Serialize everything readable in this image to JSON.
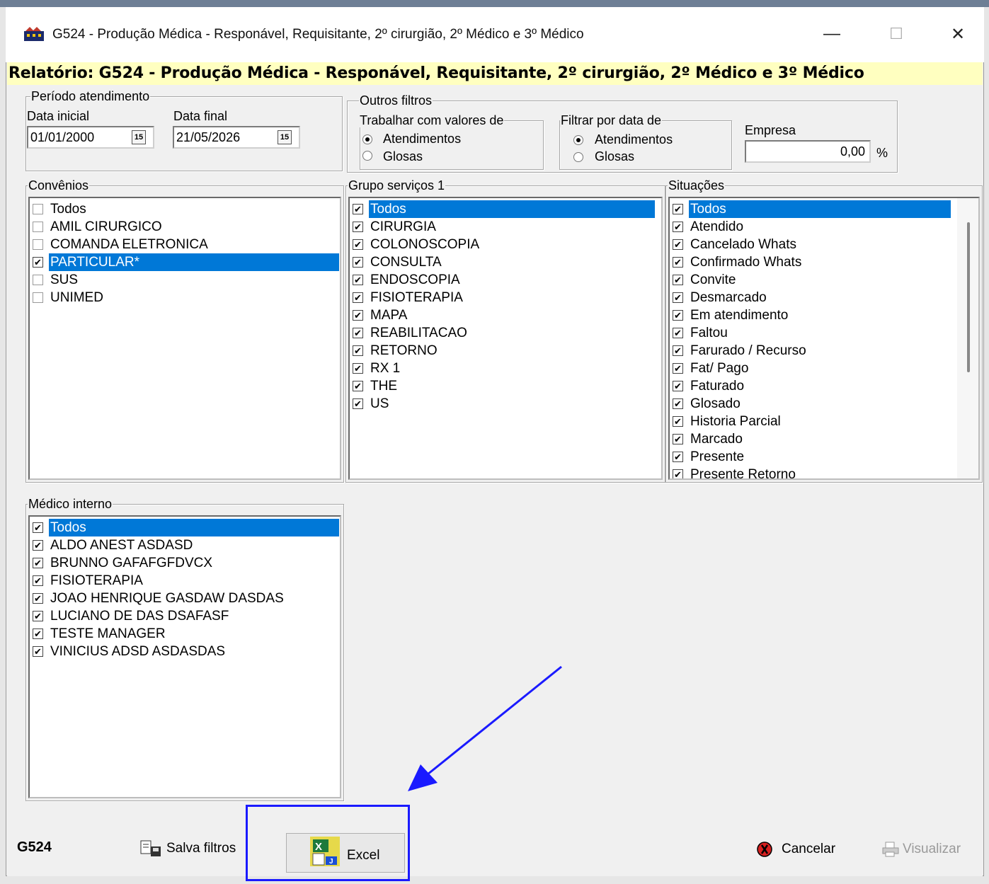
{
  "window": {
    "title": "G524 - Produção Médica - Responável, Requisitante, 2º cirurgião, 2º Médico e 3º Médico",
    "minimize": "—",
    "maximize": "☐",
    "close": "✕"
  },
  "report_header": "Relatório: G524 - Produção Médica - Responável, Requisitante, 2º cirurgião, 2º Médico e 3º Médico",
  "periodo": {
    "legend": "Período atendimento",
    "data_inicial_label": "Data inicial",
    "data_inicial": "01/01/2000",
    "data_final_label": "Data final",
    "data_final": "21/05/2026",
    "cal_icon": "15"
  },
  "outros_filtros": {
    "legend": "Outros filtros",
    "trabalhar": {
      "legend": "Trabalhar com valores de",
      "options": [
        "Atendimentos",
        "Glosas"
      ],
      "selected": "Atendimentos"
    },
    "filtrar": {
      "legend": "Filtrar por data de",
      "options": [
        "Atendimentos",
        "Glosas"
      ],
      "selected": "Atendimentos"
    },
    "empresa_label": "Empresa",
    "empresa_value": "0,00",
    "empresa_unit": "%"
  },
  "convenios": {
    "legend": "Convênios",
    "items": [
      {
        "label": "Todos",
        "checked": false,
        "selected": false
      },
      {
        "label": "AMIL  CIRURGICO",
        "checked": false,
        "selected": false
      },
      {
        "label": "COMANDA ELETRONICA",
        "checked": false,
        "selected": false
      },
      {
        "label": "PARTICULAR*",
        "checked": true,
        "selected": true
      },
      {
        "label": "SUS",
        "checked": false,
        "selected": false
      },
      {
        "label": "UNIMED",
        "checked": false,
        "selected": false
      }
    ]
  },
  "grupo_servicos": {
    "legend": "Grupo serviços 1",
    "items": [
      {
        "label": "Todos",
        "checked": true,
        "selected": true
      },
      {
        "label": "CIRURGIA",
        "checked": true,
        "selected": false
      },
      {
        "label": "COLONOSCOPIA",
        "checked": true,
        "selected": false
      },
      {
        "label": "CONSULTA",
        "checked": true,
        "selected": false
      },
      {
        "label": "ENDOSCOPIA",
        "checked": true,
        "selected": false
      },
      {
        "label": "FISIOTERAPIA",
        "checked": true,
        "selected": false
      },
      {
        "label": "MAPA",
        "checked": true,
        "selected": false
      },
      {
        "label": "REABILITACAO",
        "checked": true,
        "selected": false
      },
      {
        "label": "RETORNO",
        "checked": true,
        "selected": false
      },
      {
        "label": "RX 1",
        "checked": true,
        "selected": false
      },
      {
        "label": "THE",
        "checked": true,
        "selected": false
      },
      {
        "label": "US",
        "checked": true,
        "selected": false
      }
    ]
  },
  "situacoes": {
    "legend": "Situações",
    "items": [
      {
        "label": "Todos",
        "checked": true,
        "selected": true
      },
      {
        "label": "Atendido",
        "checked": true,
        "selected": false
      },
      {
        "label": "Cancelado Whats",
        "checked": true,
        "selected": false
      },
      {
        "label": "Confirmado Whats",
        "checked": true,
        "selected": false
      },
      {
        "label": "Convite",
        "checked": true,
        "selected": false
      },
      {
        "label": "Desmarcado",
        "checked": true,
        "selected": false
      },
      {
        "label": "Em atendimento",
        "checked": true,
        "selected": false
      },
      {
        "label": "Faltou",
        "checked": true,
        "selected": false
      },
      {
        "label": "Farurado / Recurso",
        "checked": true,
        "selected": false
      },
      {
        "label": "Fat/ Pago",
        "checked": true,
        "selected": false
      },
      {
        "label": "Faturado",
        "checked": true,
        "selected": false
      },
      {
        "label": "Glosado",
        "checked": true,
        "selected": false
      },
      {
        "label": "Historia Parcial",
        "checked": true,
        "selected": false
      },
      {
        "label": "Marcado",
        "checked": true,
        "selected": false
      },
      {
        "label": "Presente",
        "checked": true,
        "selected": false
      },
      {
        "label": "Presente Retorno",
        "checked": true,
        "selected": false
      }
    ]
  },
  "medico_interno": {
    "legend": "Médico interno",
    "items": [
      {
        "label": "Todos",
        "checked": true,
        "selected": true
      },
      {
        "label": "ALDO ANEST  ASDASD",
        "checked": true,
        "selected": false
      },
      {
        "label": "BRUNNO GAFAFGFDVCX",
        "checked": true,
        "selected": false
      },
      {
        "label": "FISIOTERAPIA",
        "checked": true,
        "selected": false
      },
      {
        "label": "JOAO HENRIQUE GASDAW DASDAS",
        "checked": true,
        "selected": false
      },
      {
        "label": "LUCIANO DE DAS DSAFASF",
        "checked": true,
        "selected": false
      },
      {
        "label": "TESTE  MANAGER",
        "checked": true,
        "selected": false
      },
      {
        "label": "VINICIUS ADSD ASDASDAS",
        "checked": true,
        "selected": false
      }
    ]
  },
  "footer": {
    "code": "G524",
    "salva_filtros": "Salva filtros",
    "excel": "Excel",
    "cancelar": "Cancelar",
    "visualizar": "Visualizar"
  },
  "colors": {
    "selection": "#0078d7",
    "report_bar": "#ffffc0",
    "annotation": "#1a1aff"
  }
}
